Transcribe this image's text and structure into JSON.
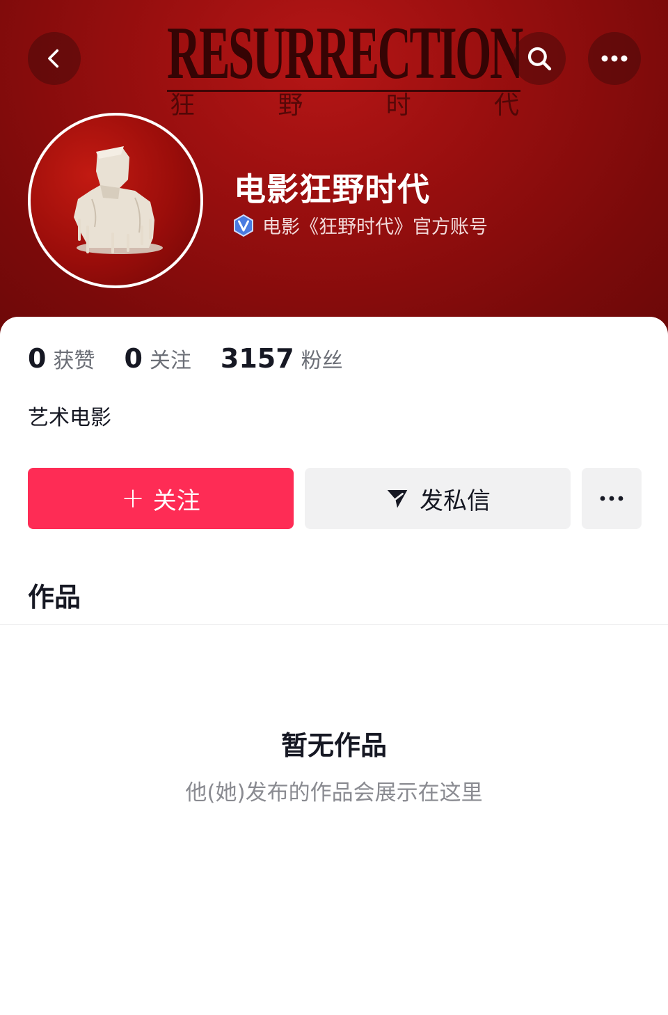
{
  "header": {
    "banner_title": "RESURRECTION",
    "banner_subtitle": [
      "狂",
      "野",
      "时",
      "代"
    ],
    "back_icon": "chevron-left-icon",
    "search_icon": "search-icon",
    "more_icon": "more-horizontal-icon"
  },
  "profile": {
    "name": "电影狂野时代",
    "verified_label": "电影《狂野时代》官方账号",
    "verified_icon": "verified-v-icon"
  },
  "stats": [
    {
      "value": "0",
      "label": "获赞"
    },
    {
      "value": "0",
      "label": "关注"
    },
    {
      "value": "3157",
      "label": "粉丝"
    }
  ],
  "bio": "艺术电影",
  "actions": {
    "follow_icon": "+",
    "follow_label": "关注",
    "message_label": "发私信",
    "message_icon": "send-icon",
    "more_icon": "more-horizontal-icon"
  },
  "tabs": {
    "works_label": "作品"
  },
  "empty_state": {
    "title": "暂无作品",
    "subtitle": "他(她)发布的作品会展示在这里"
  },
  "colors": {
    "banner_red": "#9a0f0f",
    "follow_pink": "#fe2c55",
    "button_gray": "#f1f1f2",
    "text_dark": "#161823"
  }
}
